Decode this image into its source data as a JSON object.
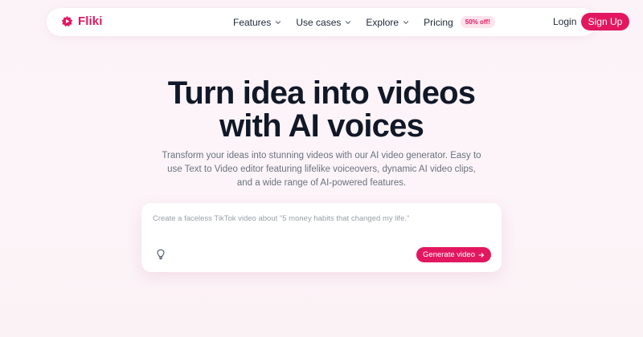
{
  "brand": {
    "name": "Fliki",
    "color": "#e3175f"
  },
  "nav": {
    "items": [
      {
        "label": "Features",
        "icon": "chevron-down-icon"
      },
      {
        "label": "Use cases",
        "icon": "chevron-down-icon"
      },
      {
        "label": "Explore",
        "icon": "chevron-down-icon"
      },
      {
        "label": "Pricing"
      }
    ],
    "pricing_badge": "50% off!",
    "login_label": "Login",
    "signup_label": "Sign Up"
  },
  "hero": {
    "title_line1": "Turn idea into videos",
    "title_line2": "with AI voices",
    "subtitle": "Transform your ideas into stunning videos with our AI video generator. Easy to use Text to Video editor featuring lifelike voiceovers, dynamic AI video clips, and a wide range of AI-powered features."
  },
  "prompt": {
    "placeholder": "Create a faceless TikTok video about \"5 money habits that changed my life.\"",
    "value": "",
    "idea_icon": "lightbulb-icon",
    "generate_label": "Generate video",
    "generate_icon": "arrow-right-icon"
  }
}
